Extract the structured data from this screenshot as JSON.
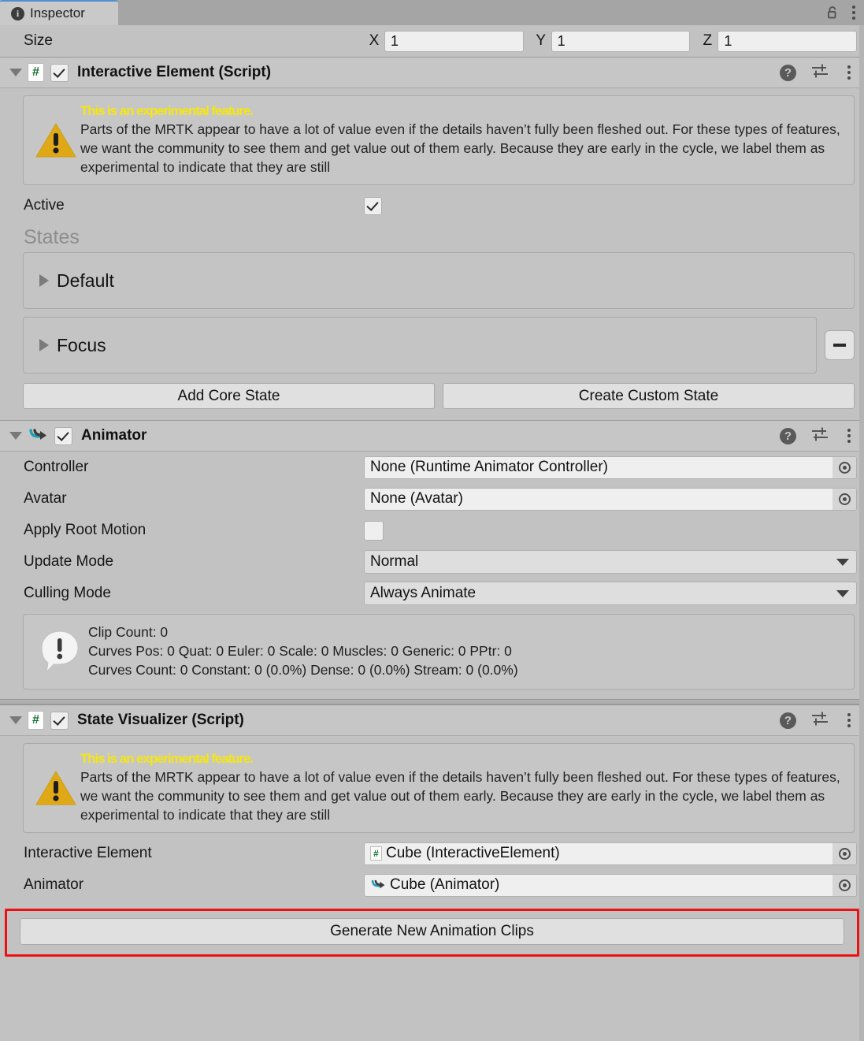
{
  "window": {
    "tab_label": "Inspector",
    "tab_icon": "info-icon",
    "lock_icon": "unlocked-padlock-icon",
    "menu_icon": "kebab-menu-icon"
  },
  "size_row": {
    "label": "Size",
    "axes": [
      {
        "axis": "X",
        "value": "1"
      },
      {
        "axis": "Y",
        "value": "1"
      },
      {
        "axis": "Z",
        "value": "1"
      }
    ]
  },
  "components": {
    "interactive_element": {
      "title": "Interactive Element (Script)",
      "enabled_checkbox": true,
      "icon": "csharp-script-icon",
      "header_actions": {
        "help": "?",
        "preset": "preset-sliders-icon",
        "menu": "kebab-menu-icon"
      },
      "warning": {
        "icon": "warning-triangle-icon",
        "title": "This is an experimental feature.",
        "body": "Parts of the MRTK appear to have a lot of value even if the details haven’t fully been fleshed out. For these types of features, we want the community to see them and get value out of them early. Because they are early in the cycle, we label them as experimental to indicate that they are still"
      },
      "active": {
        "label": "Active",
        "checked": true
      },
      "states_header": "States",
      "states": [
        {
          "name": "Default",
          "removable": false
        },
        {
          "name": "Focus",
          "removable": true,
          "remove_label": "–"
        }
      ],
      "buttons": [
        "Add Core State",
        "Create Custom State"
      ]
    },
    "animator": {
      "title": "Animator",
      "enabled_checkbox": true,
      "icon": "animator-icon",
      "properties": [
        {
          "label": "Controller",
          "type": "object",
          "value": "None (Runtime Animator Controller)"
        },
        {
          "label": "Avatar",
          "type": "object",
          "value": "None (Avatar)"
        },
        {
          "label": "Apply Root Motion",
          "type": "checkbox",
          "checked": false
        },
        {
          "label": "Update Mode",
          "type": "dropdown",
          "value": "Normal"
        },
        {
          "label": "Culling Mode",
          "type": "dropdown",
          "value": "Always Animate"
        }
      ],
      "info": {
        "icon": "info-speech-bubble-icon",
        "line1": "Clip Count: 0",
        "line2": "Curves Pos: 0 Quat: 0 Euler: 0 Scale: 0 Muscles: 0 Generic: 0 PPtr: 0",
        "line3": "Curves Count: 0 Constant: 0 (0.0%) Dense: 0 (0.0%) Stream: 0 (0.0%)"
      }
    },
    "state_visualizer": {
      "title": "State Visualizer (Script)",
      "enabled_checkbox": true,
      "icon": "csharp-script-icon",
      "warning": {
        "icon": "warning-triangle-icon",
        "title": "This is an experimental feature.",
        "body": "Parts of the MRTK appear to have a lot of value even if the details haven’t fully been fleshed out. For these types of features, we want the community to see them and get value out of them early. Because they are early in the cycle, we label them as experimental to indicate that they are still"
      },
      "properties": [
        {
          "label": "Interactive Element",
          "value": "Cube (InteractiveElement)",
          "icon": "csharp-script-icon"
        },
        {
          "label": "Animator",
          "value": "Cube (Animator)",
          "icon": "animator-icon"
        }
      ],
      "generate_button": "Generate New Animation Clips",
      "highlight_color": "#ee1111"
    }
  }
}
